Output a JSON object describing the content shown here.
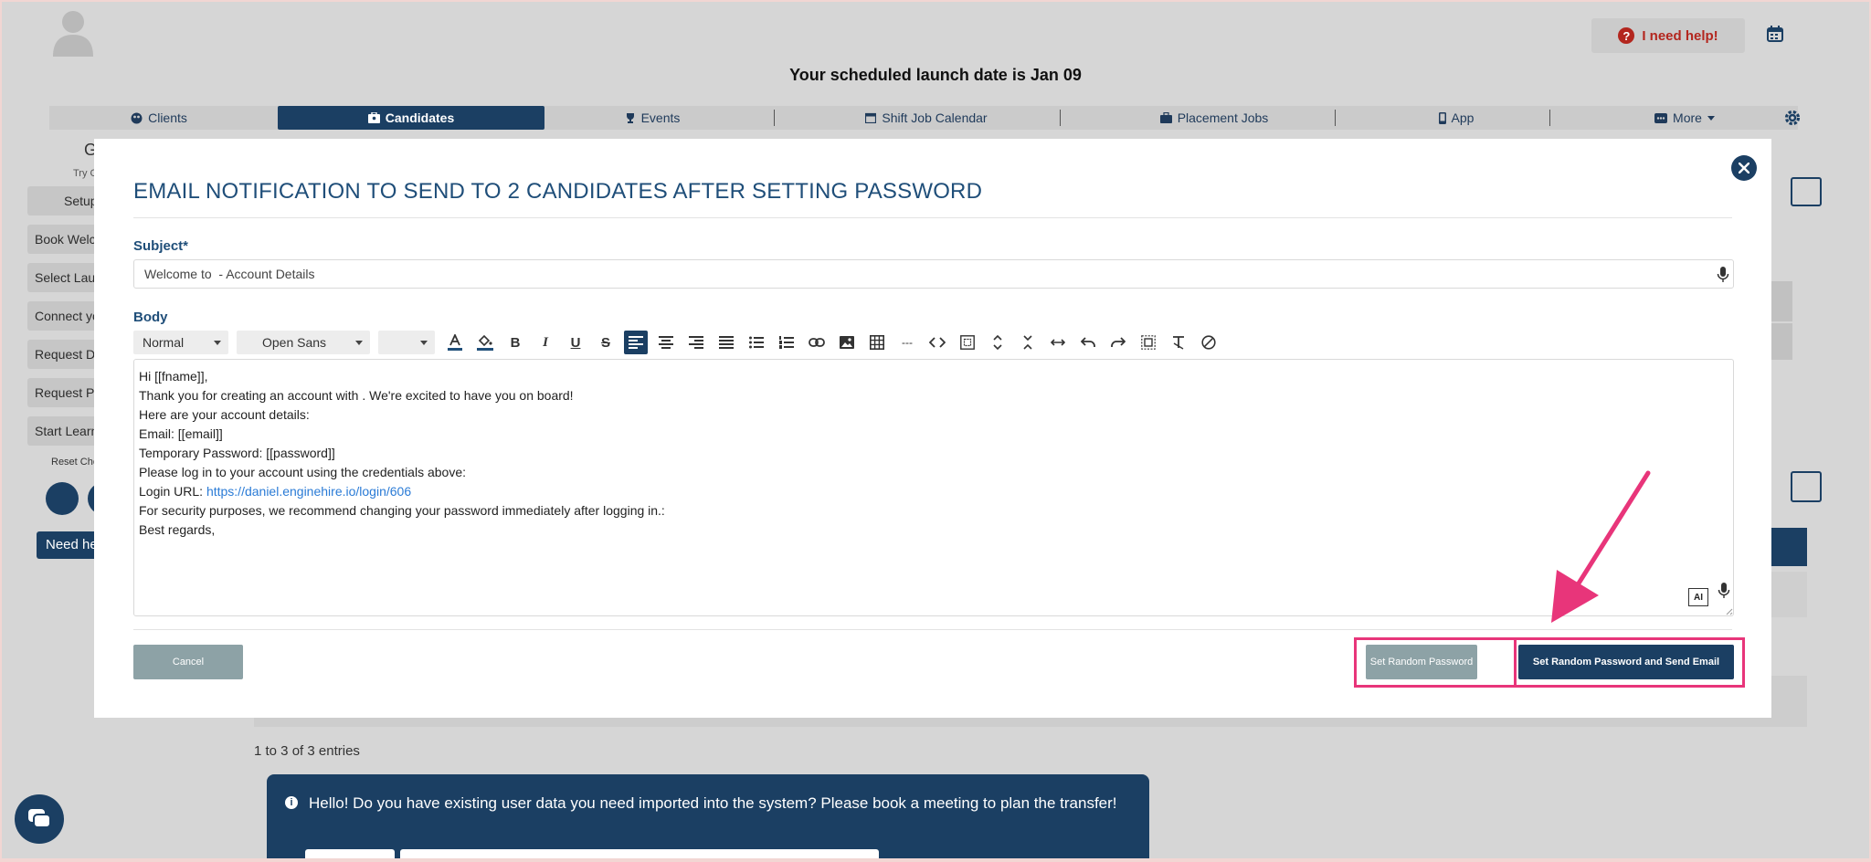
{
  "header": {
    "help_label": "I need help!",
    "launch_text": "Your scheduled launch date is Jan 09"
  },
  "nav": {
    "items": [
      {
        "label": "Clients",
        "icon": "clients-icon"
      },
      {
        "label": "Candidates",
        "icon": "candidates-icon",
        "active": true
      },
      {
        "label": "Events",
        "icon": "trophy-icon"
      },
      {
        "label": "Shift Job Calendar",
        "icon": "calendar-icon"
      },
      {
        "label": "Placement Jobs",
        "icon": "briefcase-icon"
      },
      {
        "label": "App",
        "icon": "mobile-icon"
      },
      {
        "label": "More",
        "icon": "more-icon"
      }
    ]
  },
  "background": {
    "sidebar_title": "G",
    "sidebar_sub": "Try C",
    "sidebar_buttons": [
      "Setup",
      "Book Welc",
      "Select Laun",
      "Connect yo",
      "Request D",
      "Request Pr",
      "Start Learn"
    ],
    "reset_label": "Reset Che",
    "need_help": "Need he",
    "entries": "1 to 3 of 3 entries",
    "banner_text": "Hello! Do you have existing user data you need imported into the system? Please book a meeting to plan the transfer!"
  },
  "modal": {
    "title": "EMAIL NOTIFICATION TO SEND TO 2 CANDIDATES AFTER SETTING PASSWORD",
    "subject_label": "Subject*",
    "subject_value": "Welcome to  - Account Details",
    "body_label": "Body",
    "toolbar": {
      "format": "Normal",
      "font": "Open Sans",
      "size": ""
    },
    "body_lines": [
      "Hi [[fname]],",
      "Thank you for creating an account with . We're excited to have you on board!",
      "Here are your account details:",
      "Email: [[email]]",
      "Temporary Password: [[password]]",
      "Please log in to your account using the credentials above:",
      "Login URL: ",
      "https://daniel.enginehire.io/login/606",
      "For security purposes, we recommend changing your password immediately after logging in.:",
      "Best regards,"
    ],
    "ai_badge": "AI",
    "cancel_label": "Cancel",
    "random_label": "Set Random Password",
    "random_send_label": "Set Random Password and Send Email"
  },
  "colors": {
    "primary": "#1b3f63",
    "title": "#1f4e79",
    "muted_button": "#8da2a6",
    "highlight": "#e8357a",
    "help_red": "#b3261e"
  }
}
